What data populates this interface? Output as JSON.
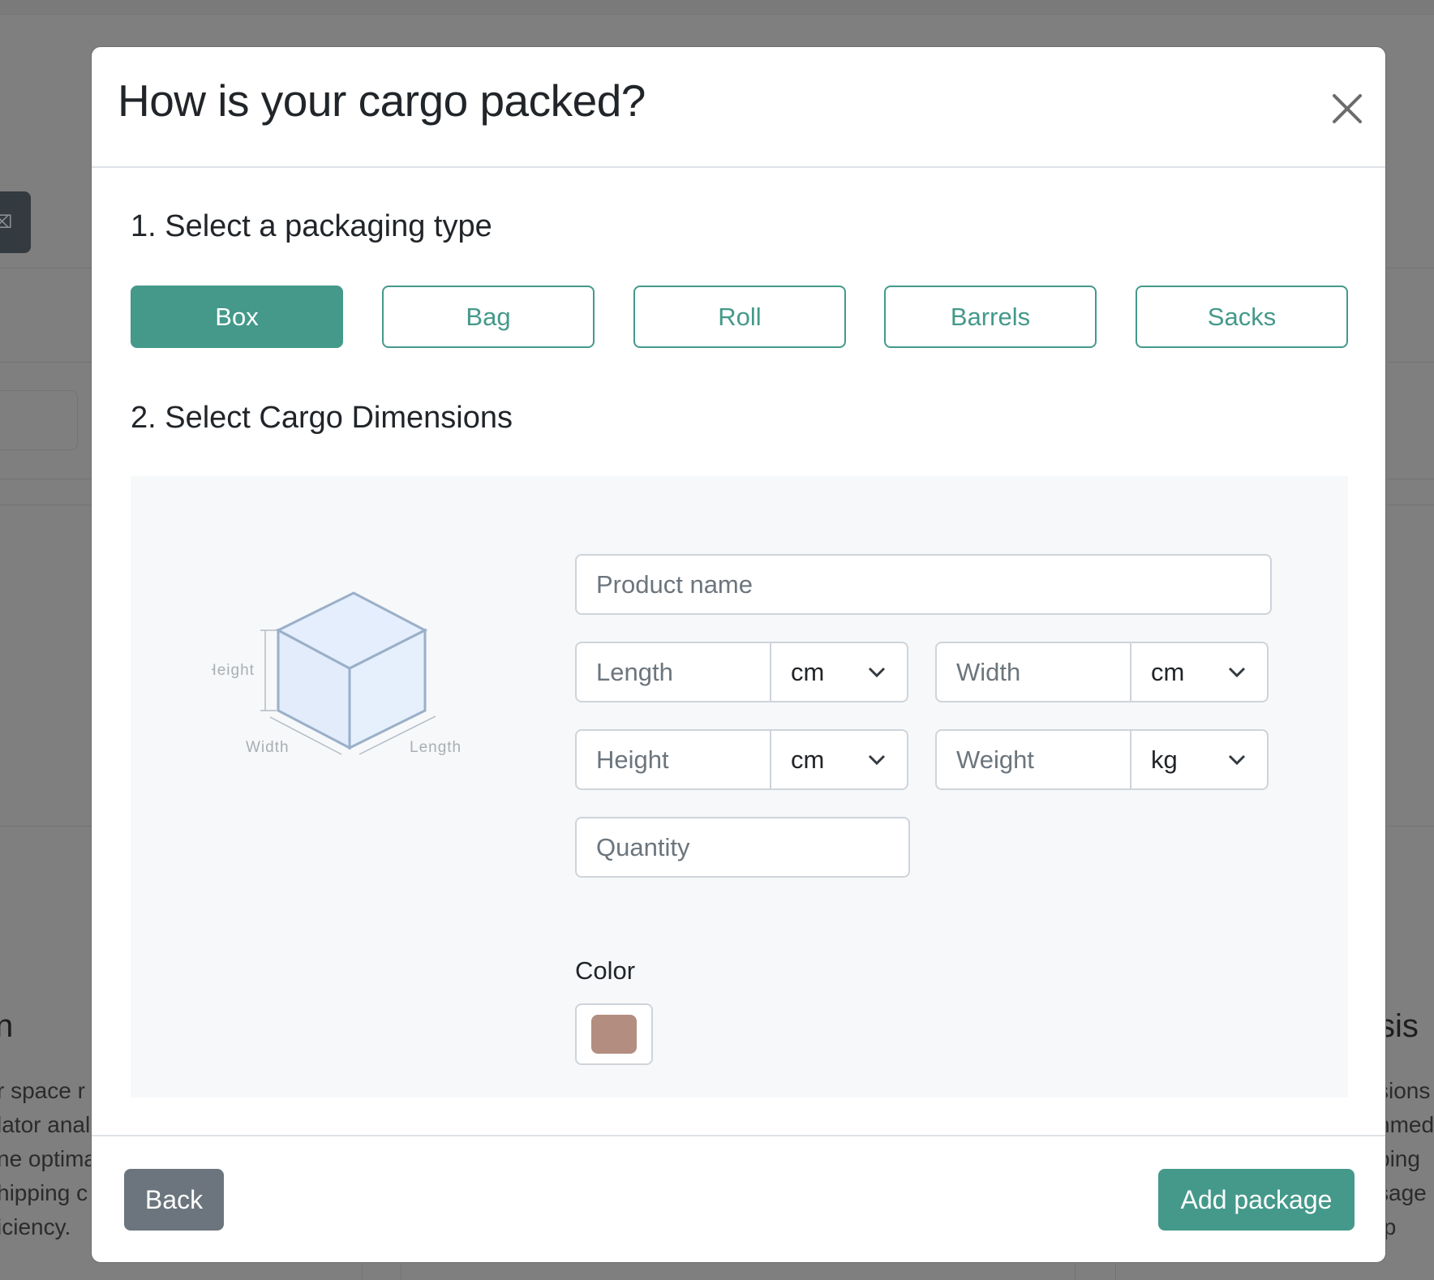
{
  "background": {
    "left_button_glyph": "⌧",
    "heading_left": "n",
    "heading_right": "sis",
    "para_left": "r space r\nlator anal\nne optima\nhipping c\niciency.",
    "para_right": "sions\nnmed\nping\nsage\n p"
  },
  "modal": {
    "title": "How is your cargo packed?",
    "close_icon": "close-icon",
    "step1_title": "1. Select a packaging type",
    "packaging_types": [
      {
        "label": "Box",
        "selected": true
      },
      {
        "label": "Bag",
        "selected": false
      },
      {
        "label": "Roll",
        "selected": false
      },
      {
        "label": "Barrels",
        "selected": false
      },
      {
        "label": "Sacks",
        "selected": false
      }
    ],
    "step2_title": "2. Select Cargo Dimensions",
    "diagram": {
      "height_label": "Height",
      "width_label": "Width",
      "length_label": "Length"
    },
    "fields": {
      "product_name_placeholder": "Product name",
      "length_placeholder": "Length",
      "length_unit": "cm",
      "width_placeholder": "Width",
      "width_unit": "cm",
      "height_placeholder": "Height",
      "height_unit": "cm",
      "weight_placeholder": "Weight",
      "weight_unit": "kg",
      "quantity_placeholder": "Quantity"
    },
    "color_label": "Color",
    "color_value": "#b38d80",
    "back_button": "Back",
    "add_button": "Add package"
  },
  "colors": {
    "accent": "#44998a",
    "secondary": "#6c757d",
    "overlay": "#808080"
  }
}
